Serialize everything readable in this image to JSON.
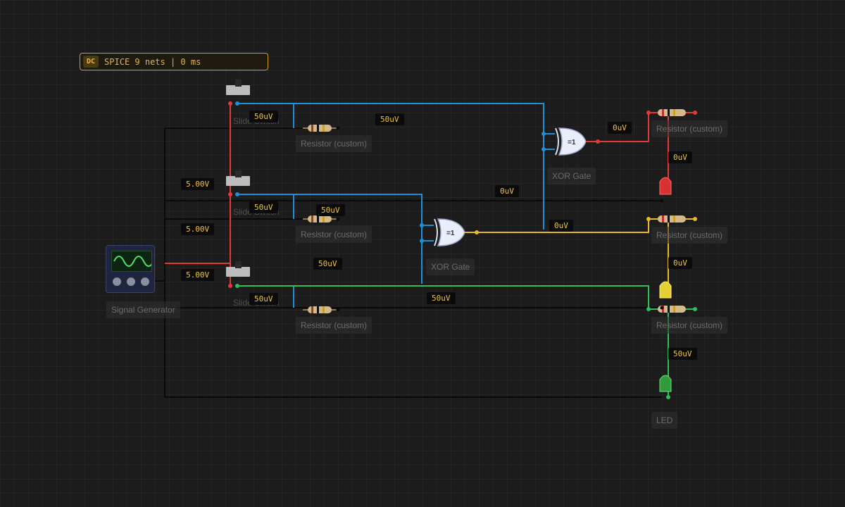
{
  "status": {
    "badge": "DC",
    "text": "SPICE 9 nets | 0 ms"
  },
  "components": {
    "slide_switch": "Slide Switch",
    "resistor": "Resistor (custom)",
    "xor_gate": "XOR Gate",
    "signal_generator": "Signal Generator",
    "led": "LED",
    "xor_symbol": "=1"
  },
  "voltages": {
    "v1": "50uV",
    "v2": "50uV",
    "v3": "0uV",
    "v4": "0uV",
    "v5": "5.00V",
    "v6": "0uV",
    "v7": "50uV",
    "v8": "50uV",
    "v9": "5.00V",
    "v10": "0uV",
    "v11": "5.00V",
    "v12": "50uV",
    "v13": "0uV",
    "v14": "50uV",
    "v15": "50uV",
    "v16": "50uV"
  },
  "colors": {
    "wire_red": "#e03a3a",
    "wire_blue": "#1f8fd6",
    "wire_yellow": "#e8b92a",
    "wire_green": "#2fbf5a",
    "wire_black": "#0a0a0a",
    "accent": "#d79a26"
  }
}
